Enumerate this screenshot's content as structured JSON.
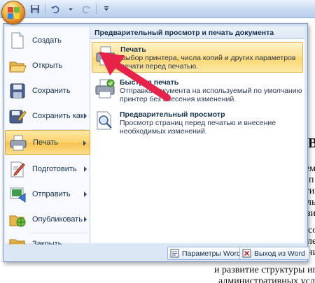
{
  "left_menu": {
    "items": [
      {
        "label": "Создать",
        "icon": "new-document-icon",
        "has_submenu": false
      },
      {
        "label": "Открыть",
        "icon": "open-folder-icon",
        "has_submenu": false
      },
      {
        "label": "Сохранить",
        "icon": "save-icon",
        "has_submenu": false
      },
      {
        "label": "Сохранить как",
        "icon": "save-as-icon",
        "has_submenu": true
      },
      {
        "label": "Печать",
        "icon": "printer-icon",
        "has_submenu": true,
        "selected": true
      },
      {
        "label": "Подготовить",
        "icon": "prepare-icon",
        "has_submenu": true
      },
      {
        "label": "Отправить",
        "icon": "send-icon",
        "has_submenu": true
      },
      {
        "label": "Опубликовать",
        "icon": "publish-icon",
        "has_submenu": true
      },
      {
        "label": "Закрыть",
        "icon": "close-folder-icon",
        "has_submenu": false
      }
    ]
  },
  "submenu": {
    "header": "Предварительный просмотр и печать документа",
    "items": [
      {
        "title": "Печать",
        "description": [
          "Выбор принтера, числа копий и других параметров",
          "печати перед печатью."
        ],
        "icon": "printer-icon",
        "selected": true
      },
      {
        "title": "Быстрая печать",
        "description": [
          "Отправка документа на используемый по умолчанию",
          "принтер без внесения изменений."
        ],
        "icon": "quick-print-icon"
      },
      {
        "title": "Предварительный просмотр",
        "description": [
          "Просмотр страниц перед печатью и внесение",
          "необходимых изменений."
        ],
        "icon": "print-preview-icon"
      }
    ]
  },
  "bottom_buttons": {
    "options": "Параметры Word",
    "exit": "Выход из Word"
  },
  "background_doc": {
    "heading_letter": "В",
    "line_fragments": [
      "ем",
      "п",
      "гиз",
      "ль",
      "зи",
      "co",
      "ле",
      "ни"
    ],
    "bottom_line_1": "и развитие структуры игро",
    "bottom_line_2": "административных услов"
  },
  "colors": {
    "selected_gradient_mid": "#fbd26a",
    "menu_background": "#dce7f5",
    "arrow": "#e8234a"
  }
}
